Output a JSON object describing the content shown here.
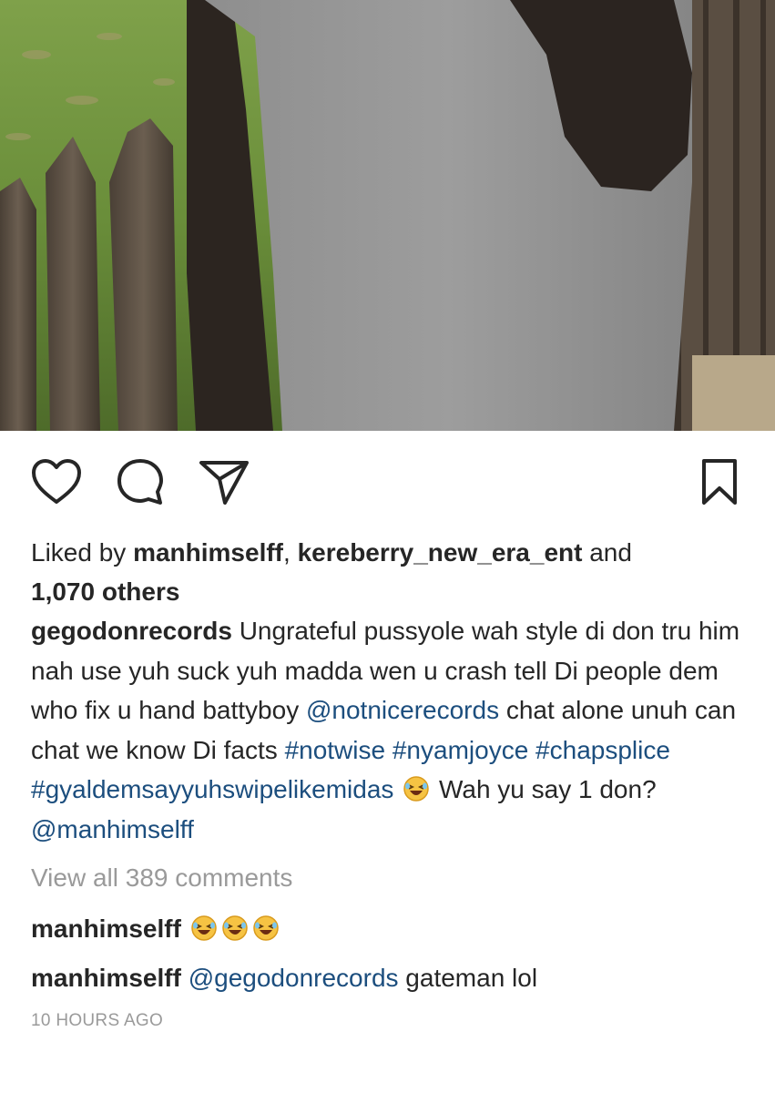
{
  "post": {
    "likes": {
      "prefix": "Liked by ",
      "user1": "manhimselff",
      "sep": ", ",
      "user2": "kereberry_new_era_ent",
      "and": " and",
      "others": "1,070 others"
    },
    "caption": {
      "author": "gegodonrecords",
      "text1": " Ungrateful pussyole wah style di don tru him nah use yuh suck yuh madda wen u crash tell Di people dem who fix u hand battyboy ",
      "mention1": "@notnicerecords",
      "text2": " chat alone unuh can chat we know Di facts  ",
      "tag1": "#notwise",
      "tag2": "#nyamjoyce",
      "tag3": "#chapsplice",
      "tag4": "#gyaldemsayyuhswipelikemidas",
      "text3": " Wah yu say 1 don? ",
      "mention2": "@manhimselff"
    },
    "view_all": "View all 389 comments",
    "comments": [
      {
        "user": "manhimselff",
        "text": "",
        "emoji": "laughing-emoji"
      },
      {
        "user": "manhimselff",
        "mention": "@gegodonrecords",
        "text": " gateman lol"
      }
    ],
    "time": "10 HOURS AGO"
  },
  "icons": {
    "like": "heart-icon",
    "comment": "comment-bubble-icon",
    "share": "paper-plane-icon",
    "save": "bookmark-icon"
  },
  "colors": {
    "mention": "#1c4e7e",
    "muted": "#9a9a9a",
    "text": "#262626"
  }
}
